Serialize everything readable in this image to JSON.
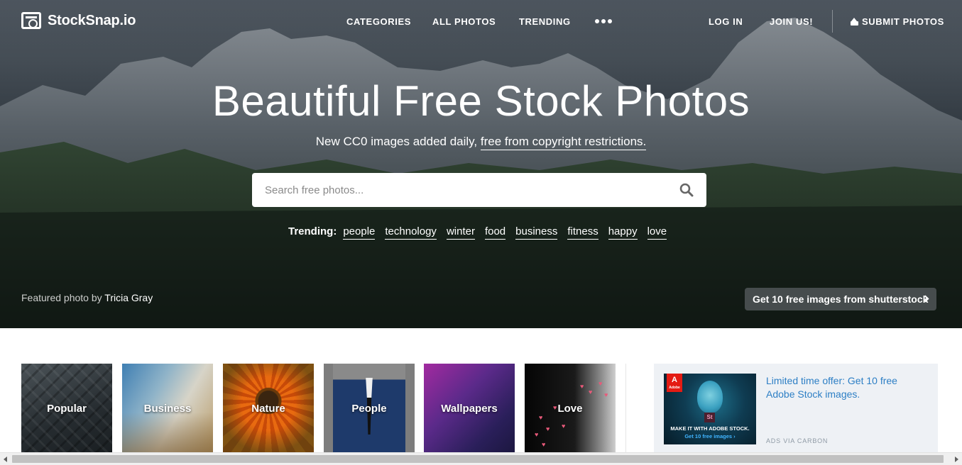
{
  "brand": {
    "name": "StockSnap.io"
  },
  "nav": {
    "categories": "CATEGORIES",
    "all_photos": "ALL PHOTOS",
    "trending": "TRENDING",
    "login": "LOG IN",
    "join": "JOIN US!",
    "submit": "SUBMIT PHOTOS"
  },
  "hero": {
    "title": "Beautiful Free Stock Photos",
    "subtitle_prefix": "New CC0 images added daily,",
    "subtitle_link": "free from copyright restrictions.",
    "search_placeholder": "Search free photos...",
    "trending_label": "Trending:",
    "trending_tags": [
      "people",
      "technology",
      "winter",
      "food",
      "business",
      "fitness",
      "happy",
      "love"
    ],
    "featured_prefix": "Featured photo by",
    "featured_author": "Tricia Gray",
    "shutterstock_cta": "Get 10 free images from shutterstock"
  },
  "categories": [
    {
      "label": "Popular"
    },
    {
      "label": "Business"
    },
    {
      "label": "Nature"
    },
    {
      "label": "People"
    },
    {
      "label": "Wallpapers"
    },
    {
      "label": "Love"
    }
  ],
  "ad": {
    "image_brand": "Adobe",
    "image_badge": "St",
    "image_caption": "MAKE IT WITH ADOBE STOCK.",
    "image_cta": "Get 10 free images ›",
    "text": "Limited time offer: Get 10 free Adobe Stock images.",
    "via": "ADS VIA CARBON"
  },
  "colors": {
    "ad_link": "#2d7fc5",
    "ad_background": "#eef1f5",
    "shutter_button": "#4b5052"
  }
}
